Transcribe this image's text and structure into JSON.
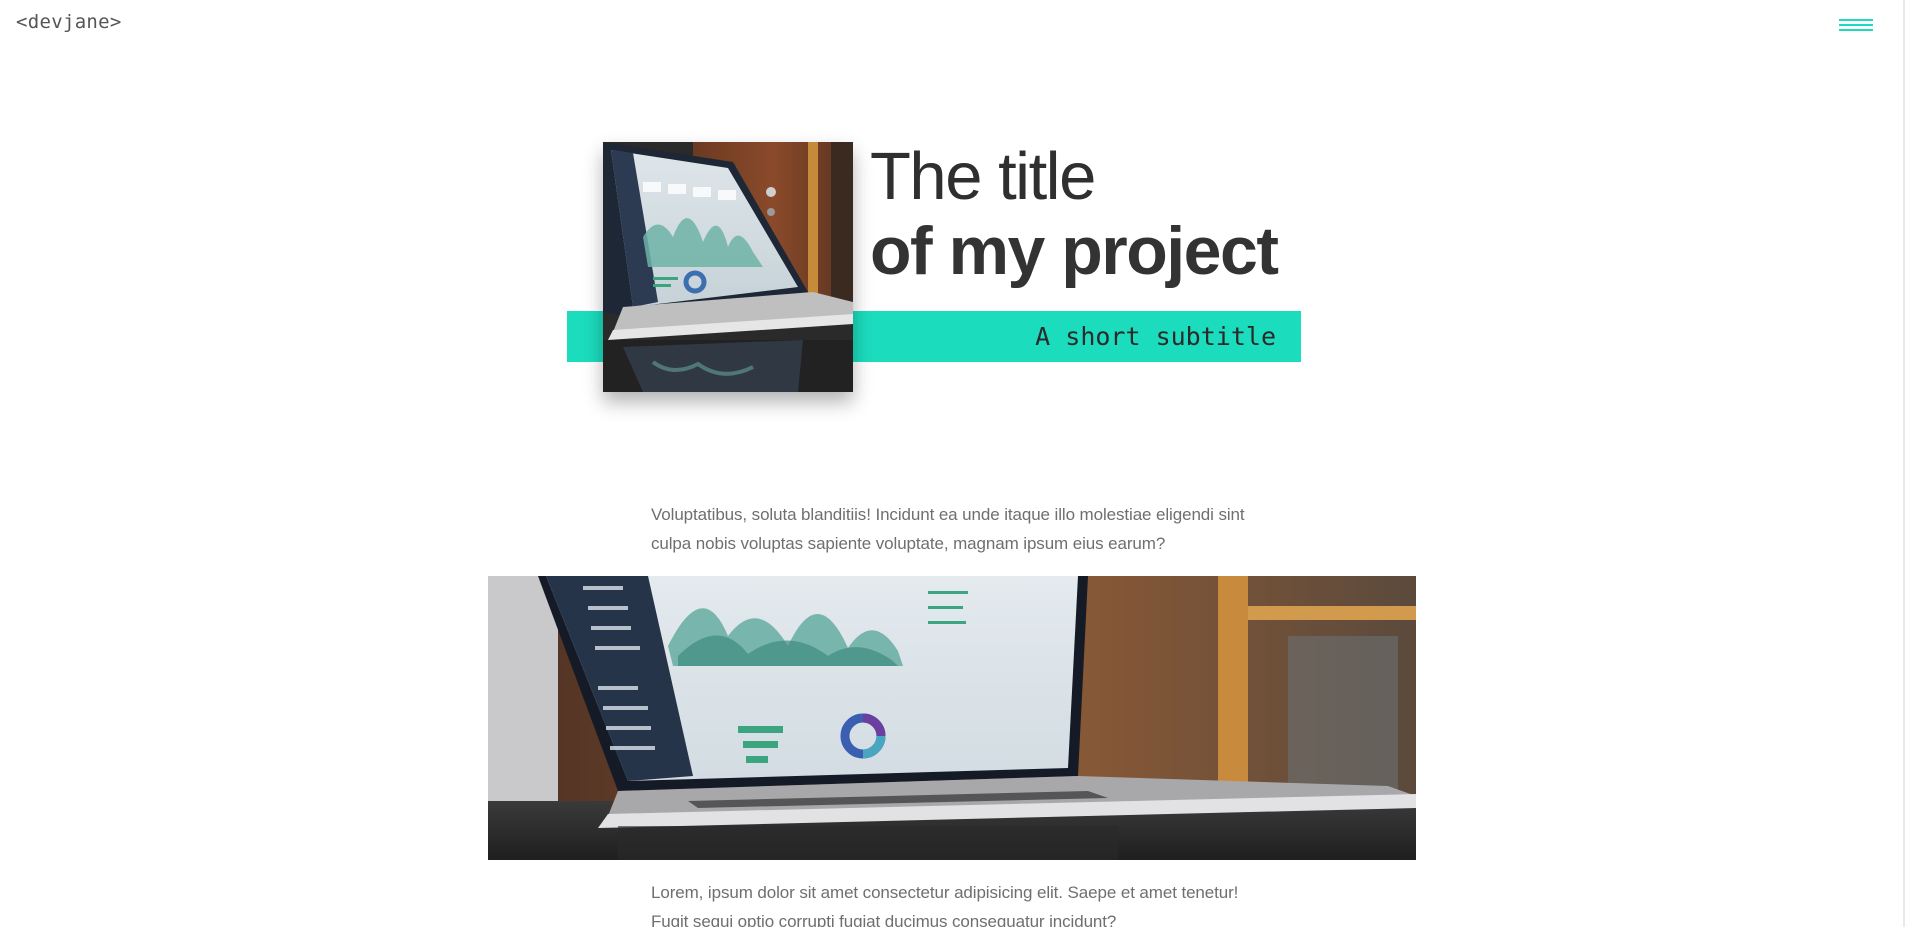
{
  "header": {
    "logo_text": "<devjane>",
    "menu_icon": "hamburger-menu-icon"
  },
  "hero": {
    "title_line1": "The title",
    "title_line2": "of my project",
    "subtitle": "A short subtitle",
    "image_alt": "Laptop showing an analytics dashboard"
  },
  "content": {
    "paragraph_1": "Voluptatibus, soluta blanditiis! Incidunt ea unde itaque illo molestiae eligendi sint culpa nobis voluptas sapiente voluptate, magnam ipsum eius earum?",
    "paragraph_2": "Lorem, ipsum dolor sit amet consectetur adipisicing elit. Saepe et amet tenetur! Fugit sequi optio corrupti fugiat ducimus consequatur incidunt?",
    "image_alt": "Laptop on a table displaying dashboard charts"
  },
  "colors": {
    "accent": "#1cdcbe",
    "text_dark": "#333333",
    "text_body": "#6f6f6f"
  }
}
